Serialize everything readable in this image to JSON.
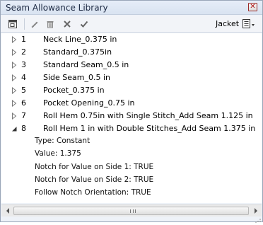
{
  "window": {
    "title": "Seam Allowance Library"
  },
  "toolbar": {
    "filter_label": "Jacket",
    "icons": [
      "new-window-icon",
      "edit-pencil-icon",
      "trash-icon",
      "close-x-icon",
      "checkmark-icon",
      "list-menu-icon"
    ]
  },
  "rows": [
    {
      "num": "1",
      "name": "Neck Line_0.375 in",
      "expanded": false
    },
    {
      "num": "2",
      "name": "Standard_0.375in",
      "expanded": false
    },
    {
      "num": "3",
      "name": "Standard Seam_0.5 in",
      "expanded": false
    },
    {
      "num": "4",
      "name": "Side Seam_0.5 in",
      "expanded": false
    },
    {
      "num": "5",
      "name": "Pocket_0.375 in",
      "expanded": false
    },
    {
      "num": "6",
      "name": "Pocket Opening_0.75 in",
      "expanded": false
    },
    {
      "num": "7",
      "name": "Roll Hem 0.75in with Single Stitch_Add Seam 1.125 in",
      "expanded": false
    },
    {
      "num": "8",
      "name": "Roll Hem 1 in with Double Stitches_Add Seam 1.375 in",
      "expanded": true
    }
  ],
  "details": [
    "Type: Constant",
    "Value: 1.375",
    "Notch for Value on Side 1: TRUE",
    "Notch for Value on Side 2: TRUE",
    "Follow Notch Orientation: TRUE"
  ],
  "colors": {
    "title_text": "#1d2a44",
    "close_red": "#b01616",
    "window_bg": "#eef2f8"
  }
}
